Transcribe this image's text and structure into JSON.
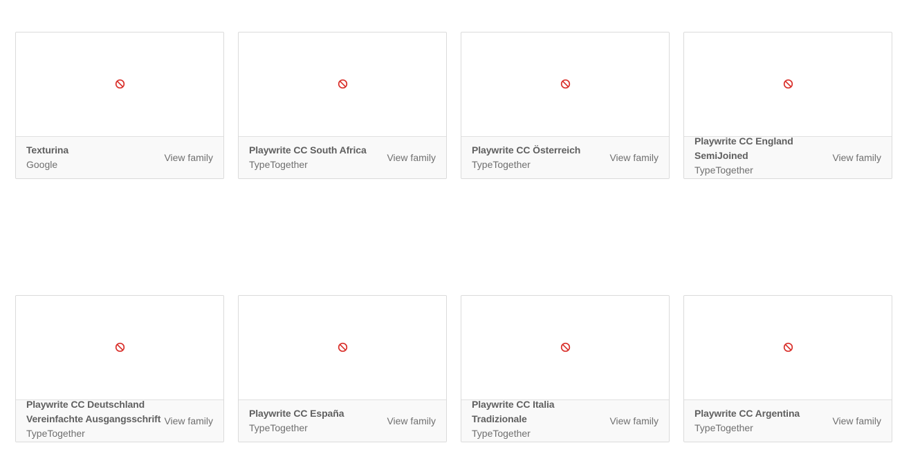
{
  "cards": [
    {
      "name": "Texturina",
      "foundry": "Google",
      "action": "View family"
    },
    {
      "name": "Playwrite CC South Africa",
      "foundry": "TypeTogether",
      "action": "View family"
    },
    {
      "name": "Playwrite CC Österreich",
      "foundry": "TypeTogether",
      "action": "View family"
    },
    {
      "name": "Playwrite CC England SemiJoined",
      "foundry": "TypeTogether",
      "action": "View family"
    },
    {
      "name": "Playwrite CC Deutschland Vereinfachte Ausgangsschrift",
      "foundry": "TypeTogether",
      "action": "View family"
    },
    {
      "name": "Playwrite CC España",
      "foundry": "TypeTogether",
      "action": "View family"
    },
    {
      "name": "Playwrite CC Italia Tradizionale",
      "foundry": "TypeTogether",
      "action": "View family"
    },
    {
      "name": "Playwrite CC Argentina",
      "foundry": "TypeTogether",
      "action": "View family"
    }
  ],
  "icons": {
    "preview_unavailable": "no-entry-icon"
  },
  "colors": {
    "icon_red": "#d9302b",
    "card_border": "#dadada",
    "footer_bg": "#f9f9f9",
    "text": "#6f6f6f"
  }
}
